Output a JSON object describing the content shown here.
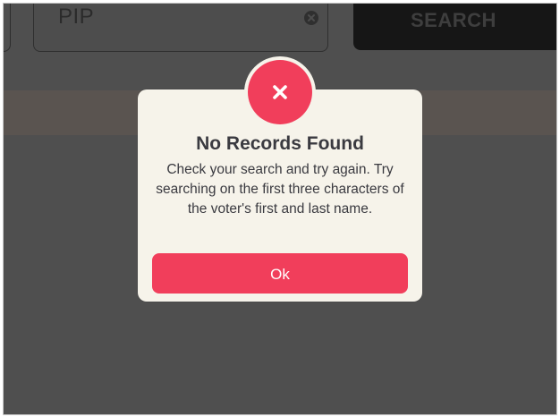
{
  "search": {
    "value": "PIP",
    "button_label": "SEARCH"
  },
  "dialog": {
    "icon": "close-x-icon",
    "title": "No Records Found",
    "message": "Check your search and try again. Try searching on the first three characters of the voter's first and last name.",
    "ok_label": "Ok"
  },
  "colors": {
    "accent": "#f13e5b",
    "dialog_bg": "#f6f3ea",
    "overlay": "#4f4f4f"
  }
}
